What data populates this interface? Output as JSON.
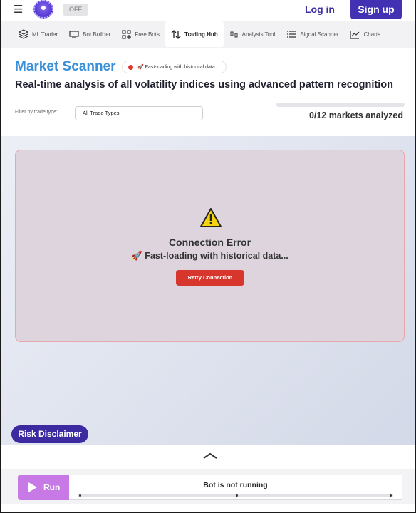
{
  "topbar": {
    "toggle": "OFF",
    "login": "Log in",
    "signup": "Sign up"
  },
  "tabs": [
    {
      "label": "ML Trader",
      "icon": "layers-icon"
    },
    {
      "label": "Bot Builder",
      "icon": "monitor-icon"
    },
    {
      "label": "Free Bots",
      "icon": "grid-plus-icon"
    },
    {
      "label": "Trading Hub",
      "icon": "swap-arrows-icon",
      "active": true
    },
    {
      "label": "Analysis Tool",
      "icon": "candlestick-icon"
    },
    {
      "label": "Signal Scanner",
      "icon": "list-icon"
    },
    {
      "label": "Charts",
      "icon": "line-chart-icon"
    }
  ],
  "header": {
    "title": "Market Scanner",
    "status_pill": "🚀 Fast-loading with historical data...",
    "subtitle": "Real-time analysis of all volatility indices using advanced pattern recognition",
    "filter_label": "Filter by trade type:",
    "filter_value": "All Trade Types",
    "progress_fraction": 0,
    "analyzed_text": "0/12 markets analyzed"
  },
  "error": {
    "title": "Connection Error",
    "message": "🚀 Fast-loading with historical data...",
    "retry_label": "Retry Connection"
  },
  "risk_label": "Risk Disclaimer",
  "runbar": {
    "run_label": "Run",
    "status": "Bot is not running"
  },
  "colors": {
    "brand": "#4232b3",
    "title": "#3a8fd9",
    "error_button": "#d7362c",
    "run_button": "#c77ae6"
  }
}
